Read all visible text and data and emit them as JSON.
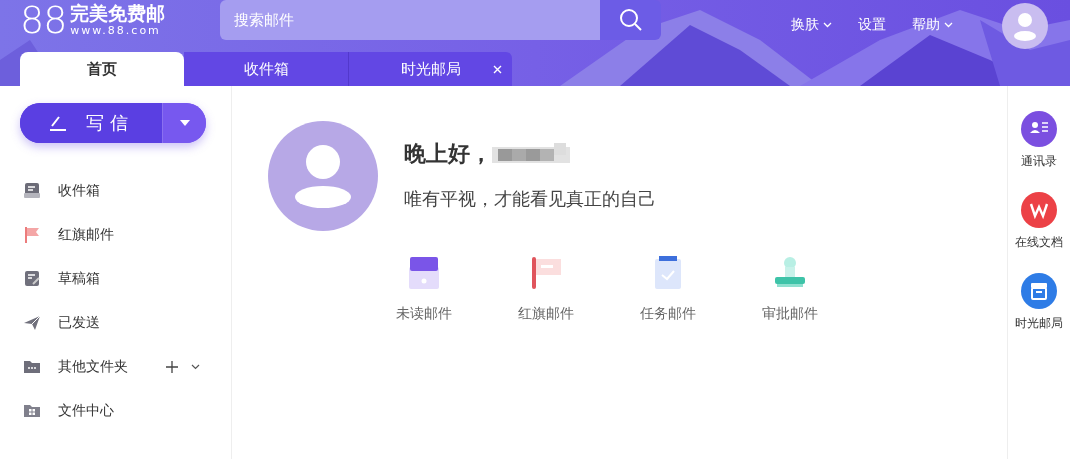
{
  "logo": {
    "number": "88",
    "name": "完美免费邮",
    "domain": "www.88.com"
  },
  "search": {
    "placeholder": "搜索邮件"
  },
  "top_nav": [
    {
      "label": "换肤",
      "dropdown": true
    },
    {
      "label": "设置",
      "dropdown": false
    },
    {
      "label": "帮助",
      "dropdown": true
    }
  ],
  "tabs": [
    {
      "label": "首页",
      "selected": true,
      "closable": false
    },
    {
      "label": "收件箱",
      "selected": false,
      "closable": false
    },
    {
      "label": "时光邮局",
      "selected": false,
      "closable": true
    }
  ],
  "compose": {
    "label": "写信"
  },
  "folders": [
    {
      "label": "收件箱",
      "kind": "inbox",
      "actions": false
    },
    {
      "label": "红旗邮件",
      "kind": "flag",
      "actions": false
    },
    {
      "label": "草稿箱",
      "kind": "draft",
      "actions": false
    },
    {
      "label": "已发送",
      "kind": "sent",
      "actions": false
    },
    {
      "label": "其他文件夹",
      "kind": "folder",
      "actions": true
    },
    {
      "label": "文件中心",
      "kind": "files",
      "actions": false
    }
  ],
  "greeting": "晚上好，",
  "motto": "唯有平视，才能看见真正的自己",
  "shortcuts": [
    {
      "label": "未读邮件",
      "kind": "unread"
    },
    {
      "label": "红旗邮件",
      "kind": "flag"
    },
    {
      "label": "任务邮件",
      "kind": "task"
    },
    {
      "label": "审批邮件",
      "kind": "approval"
    }
  ],
  "right_rail": [
    {
      "label": "通讯录",
      "kind": "contacts"
    },
    {
      "label": "在线文档",
      "kind": "docs"
    },
    {
      "label": "时光邮局",
      "kind": "timebox"
    }
  ]
}
